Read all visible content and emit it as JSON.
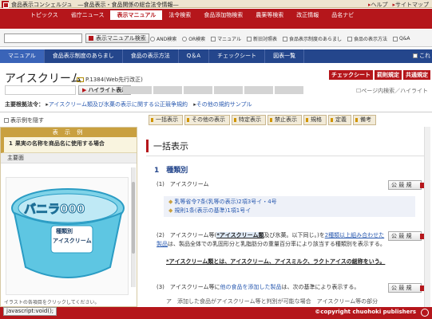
{
  "site": {
    "title": "食品表示コンシェルジュ　―食品表示・食品関係の総合法令情報―",
    "help": "ヘルプ",
    "sitemap": "サイトマップ"
  },
  "nav": {
    "tabs": [
      "トピックス",
      "省庁ニュース",
      "表示マニュアル",
      "法令検索",
      "食品添加物検索",
      "農薬等検索",
      "改正情報",
      "品名ナビ"
    ],
    "active": "表示マニュアル"
  },
  "search": {
    "button": "表示マニュアル検索",
    "options": [
      "AND検索",
      "OR検索",
      "マニュアル",
      "新旧対照表",
      "食品表示制度のあらまし",
      "食品の表示方法",
      "Q&A"
    ]
  },
  "subnav": {
    "items": [
      "マニュアル",
      "食品表示制度のあらまし",
      "食品の表示方法",
      "Q＆A",
      "チェックシート",
      "図表一覧"
    ],
    "right": "これ"
  },
  "page": {
    "title": "アイスクリーム",
    "ref": "P.1384(Web先行改正)",
    "buttons": [
      "チェックシート",
      "罰則規定",
      "共通規定"
    ],
    "highlight_button": "ハイライト表示",
    "page_search": "ページ内検索／ハイライト"
  },
  "law": {
    "label": "主要根拠法令：",
    "item1": "アイスクリーム類及び氷菓の表示に関する公正競争規約",
    "item2": "その他の規約サンプル"
  },
  "show_example": "表示例を隠す",
  "toolbar": [
    "一括表示",
    "その他の表示",
    "特定表示",
    "禁止表示",
    "規格",
    "定義",
    "備考"
  ],
  "left_panel": {
    "header": "表 示 例",
    "item_num": "1",
    "item_title": "果実の名称を商品名に使用する場合",
    "section": "主要面",
    "img_text1": "バニラ000",
    "img_text2": "種類別",
    "img_text3": "アイスクリーム",
    "caption": "イラストの各項目をクリックしてください。"
  },
  "content": {
    "heading": "一括表示",
    "section_num": "1",
    "section_title": "種類別",
    "item1_num": "(1)",
    "item1_text": "アイスクリーム",
    "ref1": "乳等省令7条(乳等の表示)2項3号イ・4号",
    "ref2": "規則1条(表示の基準)1項1号イ",
    "item2_num": "(2)",
    "item2_a": "アイスクリーム等(",
    "item2_b": "*アイスクリーム類",
    "item2_c": "及び氷菓。以下同じ。)を",
    "item2_d": "2種類以上組み合わせた製品",
    "item2_e": "は、製品全体での乳固形分と乳脂肪分の重量百分率により該当する種類別を表示する。",
    "item2_note": "*アイスクリーム類とは、アイスクリーム、アイスミルク、ラクトアイスの総称をいう。",
    "item3_num": "(3)",
    "item3_a": "アイスクリーム等に",
    "item3_b": "他の食品を添加した製品",
    "item3_c": "は、次の基準により表示する。",
    "item3_sub": "ア　添加した食品がアイスクリーム等と判別が可能な場合　アイスクリーム等の部分",
    "koki": "公 競 規"
  },
  "status": "javascript:void();",
  "copyright": "©copyright chuohoki publishers"
}
